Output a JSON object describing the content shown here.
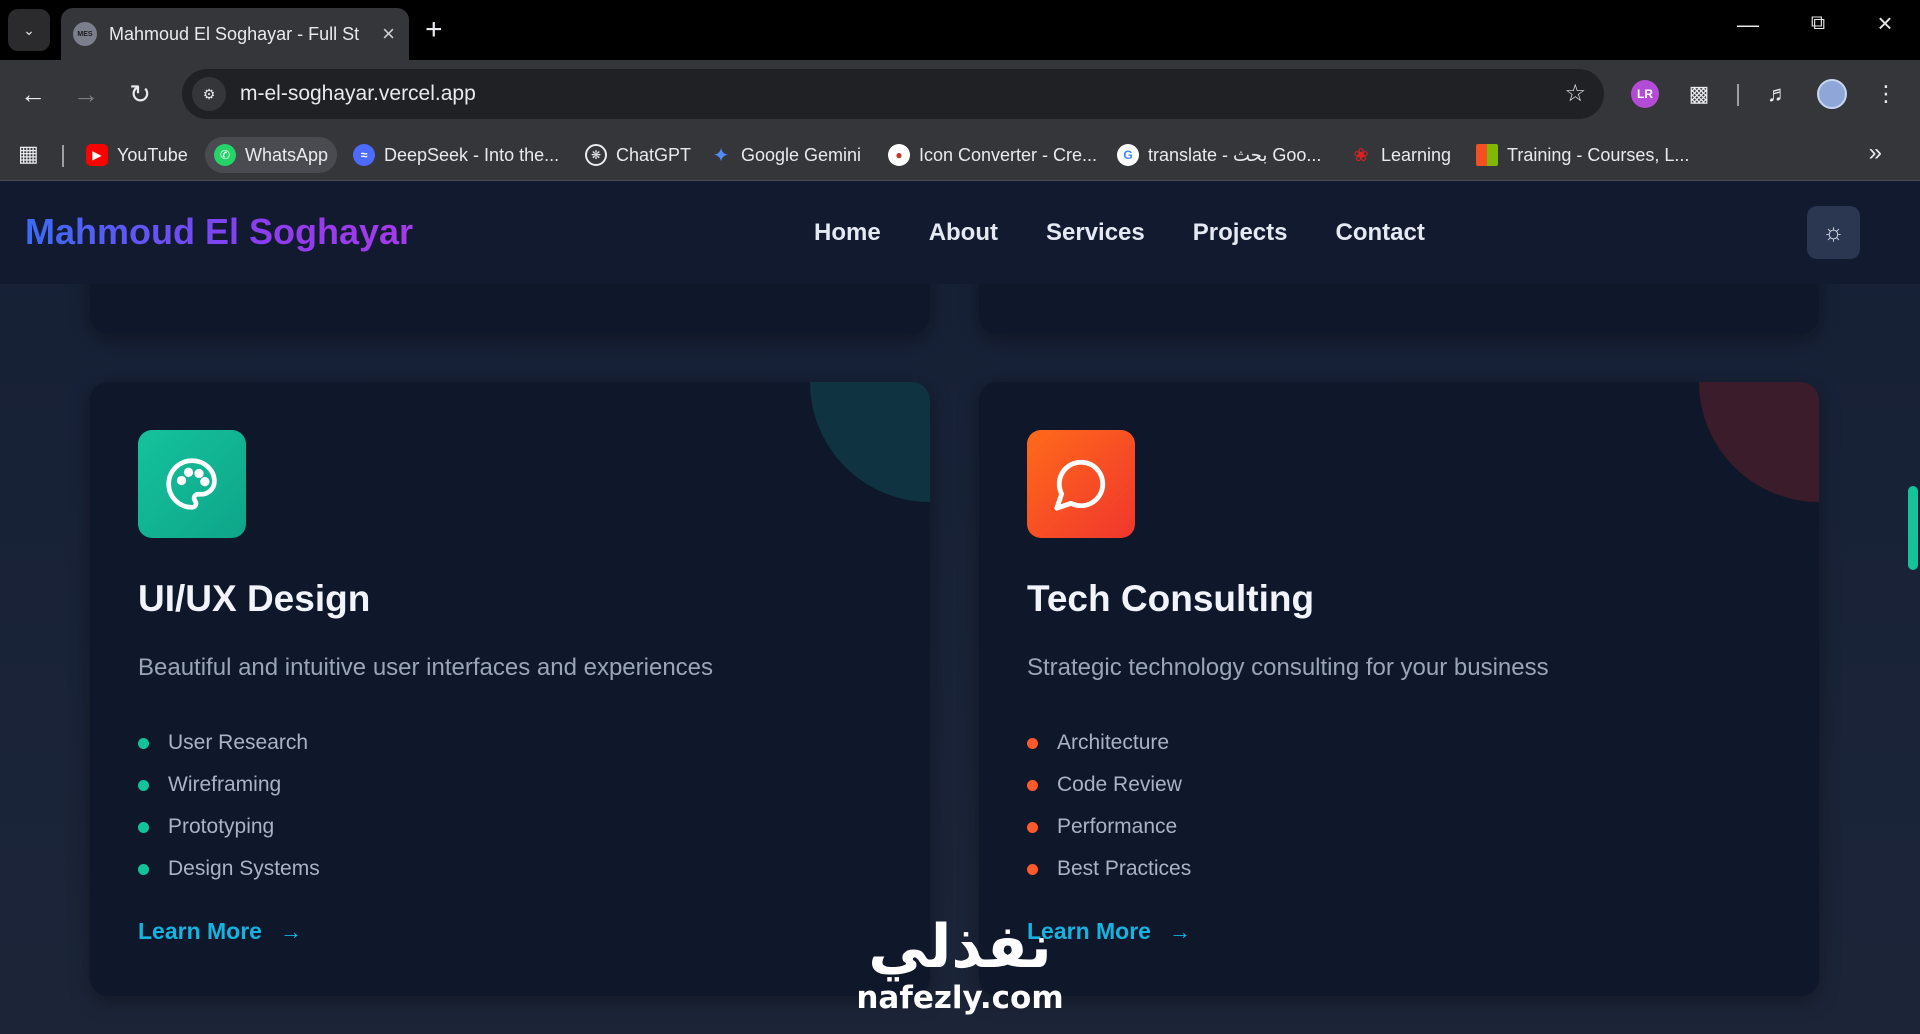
{
  "browser": {
    "tab_title": "Mahmoud El Soghayar - Full St",
    "tab_favicon_text": "MES",
    "url": "m-el-soghayar.vercel.app",
    "extension_badge": "LR",
    "bookmarks": [
      {
        "label": "YouTube",
        "icon": "youtube-icon",
        "color": "#ff0000"
      },
      {
        "label": "WhatsApp",
        "icon": "whatsapp-icon",
        "color": "#25d366"
      },
      {
        "label": "DeepSeek - Into the...",
        "icon": "deepseek-icon",
        "color": "#4d6bfe"
      },
      {
        "label": "ChatGPT",
        "icon": "chatgpt-icon",
        "color": "#e8eaed"
      },
      {
        "label": "Google Gemini",
        "icon": "gemini-icon",
        "color": "#4f8cf7"
      },
      {
        "label": "Icon Converter - Cre...",
        "icon": "icon-converter-icon",
        "color": "#c0392b"
      },
      {
        "label": "translate - بحث Goo...",
        "icon": "google-icon",
        "color": "#4285f4"
      },
      {
        "label": "Learning",
        "icon": "huawei-icon",
        "color": "#e02020"
      },
      {
        "label": "Training - Courses, L...",
        "icon": "microsoft-icon",
        "color": "#f25022"
      }
    ]
  },
  "site": {
    "brand": "Mahmoud El Soghayar",
    "nav": [
      "Home",
      "About",
      "Services",
      "Projects",
      "Contact"
    ]
  },
  "services": [
    {
      "title": "UI/UX Design",
      "description": "Beautiful and intuitive user interfaces and experiences",
      "features": [
        "User Research",
        "Wireframing",
        "Prototyping",
        "Design Systems"
      ],
      "cta": "Learn More",
      "icon": "palette-icon",
      "accent": "#12c39a"
    },
    {
      "title": "Tech Consulting",
      "description": "Strategic technology consulting for your business",
      "features": [
        "Architecture",
        "Code Review",
        "Performance",
        "Best Practices"
      ],
      "cta": "Learn More",
      "icon": "chat-bubble-icon",
      "accent": "#ff5a2a"
    }
  ],
  "watermark": {
    "arabic": "نفذلي",
    "latin": "nafezly.com"
  }
}
